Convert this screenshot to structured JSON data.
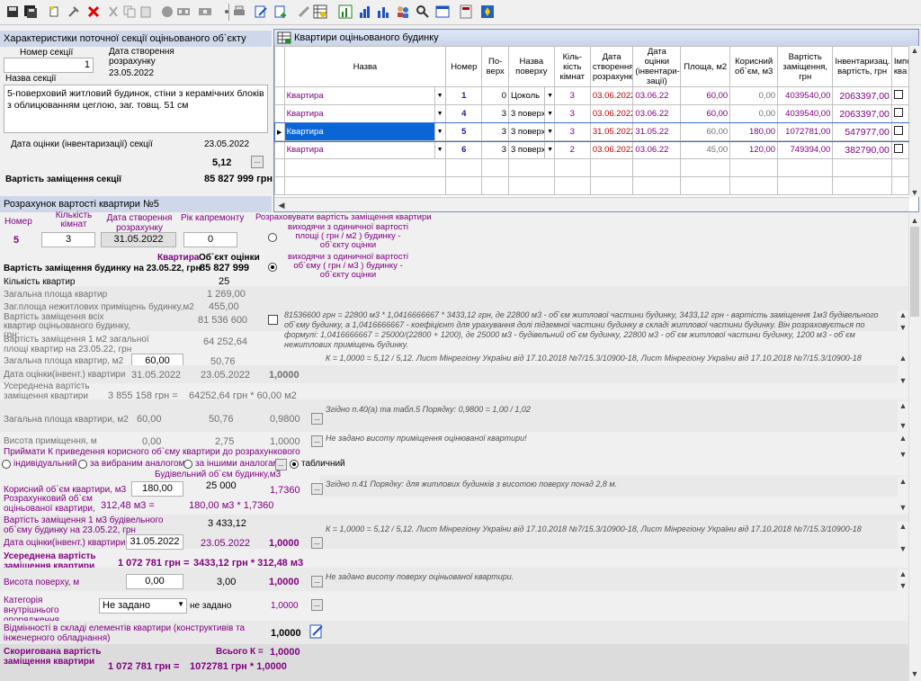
{
  "toolbar": {
    "icons": [
      "save-icon",
      "save-all-icon",
      "new-icon",
      "tools-icon",
      "delete-icon",
      "cut-icon",
      "copy-icon",
      "paste-icon",
      "circle-icon",
      "grid-icon",
      "grid2-icon",
      "dot-icon",
      "print-icon",
      "edit-icon",
      "add-icon",
      "pen-icon",
      "table-icon",
      "chart-icon",
      "chart2-icon",
      "users-icon",
      "search-icon",
      "window-icon",
      "calculator-icon",
      "emblem-icon"
    ]
  },
  "section": {
    "header": "Характеристики поточної секції оціньованого об`єкту",
    "num_label": "Номер секції",
    "num_value": "1",
    "date_label": "Дата створення розрахунку",
    "date_value": "23.05.2022",
    "name_label": "Назва секції",
    "description": "5-поверховий житловий будинок, стіни з керамічних блоків з облицюванням цеглою, заг. товщ. 51 см",
    "eval_date_label": "Дата оцінки (інвентаризації) секції",
    "eval_date_value": "23.05.2022",
    "k_value": "5,12",
    "cost_label": "Вартість заміщення секції",
    "cost_value": "85 827 999 грн"
  },
  "apt": {
    "header": "Розрахунок вартості квартири №5",
    "num_label": "Номер",
    "num_value": "5",
    "rooms_label": "Кількість кімнат",
    "rooms_value": "3",
    "created_label": "Дата створення розрахунку",
    "created_value": "31.05.2022",
    "repair_label": "Рік капремонту",
    "repair_value": "0",
    "calc_label": "Розраховувати вартість заміщення квартири",
    "radio1": "виходячи з одиничної вартості площі ( грн / м2 ) будинку - об`єкту оцінки",
    "radio2": "виходячи з одиничної вартості об`єму ( грн / м3 ) будинку - об`єкту оцінки",
    "col_apt": "Квартира",
    "col_obj": "Об`єкт оцінки",
    "bld_cost_label": "Вартість заміщення будинку на 23.05.22, грн",
    "bld_cost_value": "85 827 999",
    "rooms_count_label": "Кількість квартир",
    "rooms_count_value": "25",
    "total_area_label": "Загальна площа квартир",
    "total_area_value": "1 269,00",
    "nonres_label": "Заг.площа нежитлових приміщень будинку,м2",
    "nonres_value": "455,00",
    "all_apts_label": "Вартість заміщення всіх квартир оціньованого будинку, грн:",
    "all_apts_value": "81 536 600",
    "formula_note": "81536600 грн = 22800 м3 * 1,0416666667 * 3433,12 грн, де 22800 м3 - об`єм житлової частини будинку, 3433,12 грн - вартість заміщення 1м3 будівельного об`єму будинку, а 1,0416666667 - коефіцієнт для урахування долі підземної частини будинку в складі житлової частини будинку. Він розраховується по формулі: 1,0416666667 = 25000/(22800 + 1200), де 25000 м3 - будівельний об`єм будинку, 22800 м3 - об`єм житлової частини будинку, 1200 м3 - об`єм нежитлових приміщень будинку.",
    "cost_m2_label": "Вартість заміщення 1 м2 загальної площі квартир на 23.05.22, грн",
    "cost_m2_value": "64 252,64",
    "area_label": "Загальна площа квартир, м2",
    "area_apt": "60,00",
    "area_obj": "50,76",
    "eval_date_label": "Дата оцінки(інвент.) квартири",
    "eval_apt": "31.05.2022",
    "eval_obj": "23.05.2022",
    "eval_k": "1,0000",
    "k_note": "К = 1,0000 = 5,12 / 5,12. Лист Мінрегіону України від 17.10.2018 №7/15.3/10900-18, Лист Мінрегіону України від 17.10.2018 №7/15.3/10900-18",
    "avg_label": "Усереднена вартість заміщення квартири",
    "avg_value": "3 855 158 грн =",
    "avg_formula": "64252,64 грн * 60,00 м2",
    "area2_label": "Загальна площа квартири, м2",
    "area2_apt": "60,00",
    "area2_obj": "50,76",
    "area2_k": "0,9800",
    "area2_note": "Згідно п.40(а) та табл.5 Порядку: 0,9800 = 1,00 / 1,02",
    "height_label": "Висота приміщення, м",
    "height_apt": "0,00",
    "height_obj": "2,75",
    "height_k": "1,0000",
    "height_note": "Не задано висоту приміщення оцінюваної квартири!",
    "adopt_label": "Приймати К приведення корисного об`єму квартири до розрахункового",
    "opt1": "індивідуальний",
    "opt2": "за вибраним аналогом",
    "opt3": "за іншими аналогами",
    "opt4": "табличний",
    "bvol_label": "Будівельний об`єм будинку,м3",
    "bvol_value": "25 000",
    "usable_label": "Корисний об`єм квартири, м3",
    "usable_value": "180,00",
    "usable_k": "1,7360",
    "usable_note": "Згідно п.41 Порядку:  для житлових будинків з висотою поверху понад 2,8 м.",
    "calcvol_label": "Розрахунковий об`єм оціньованої квартири, м3",
    "calcvol_value": "312,48 м3 =",
    "calcvol_formula": "180,00 м3 * 1,7360",
    "cost_m3_label": "Вартість заміщення 1 м3 будівельного об`єму будинку на 23.05.22, грн",
    "cost_m3_value": "3 433,12",
    "eval2_label": "Дата оцінки(інвент.) квартири",
    "eval2_apt": "31.05.2022",
    "eval2_obj": "23.05.2022",
    "eval2_k": "1,0000",
    "eval2_note": "К = 1,0000 = 5,12 / 5,12. Лист Мінрегіону України від 17.10.2018 №7/15.3/10900-18, Лист Мінрегіону України від 17.10.2018 №7/15.3/10900-18",
    "avg2_label": "Усереднена вартість заміщення квартири",
    "avg2_value": "1 072 781 грн =",
    "avg2_formula": "3433,12 грн * 312,48 м3",
    "floor_h_label": "Висота поверху, м",
    "floor_h_apt": "0,00",
    "floor_h_obj": "3,00",
    "floor_h_k": "1,0000",
    "floor_h_note": "Не задано висоту поверху оціньованої квартири.",
    "finish_label": "Категорія внутрішнього опорядження",
    "finish_value": "Не задано",
    "finish_obj": "не задано",
    "finish_k": "1,0000",
    "diff_label": "Відмінності в складі елементів квартири (конструктивів та інженерного обладнання)",
    "diff_k": "1,0000",
    "adj_label": "Скоригована вартість заміщення квартири",
    "total_k_label": "Всього К =",
    "total_k": "1,0000",
    "adj_value": "1 072 781 грн =",
    "adj_formula": "1072781 грн * 1,0000"
  },
  "window": {
    "title": "Квартири оціньованого будинку",
    "headers": [
      "Назва",
      "Номер",
      "По-верх",
      "Назва поверху",
      "Кіль-кість кімнат",
      "Дата створення розрахунку",
      "Дата оцінки (інвентари-зації)",
      "Площа, м2",
      "Корисний об`єм, м3",
      "Вартість заміщення, грн",
      "Інвентаризац. вартість, грн",
      "Імпо ква"
    ],
    "rows": [
      {
        "name": "Квартира",
        "num": "1",
        "floor": "0",
        "floor_name": "Цоколь",
        "rooms": "3",
        "created": "03.06.2022",
        "eval": "03.06.22",
        "area": "60,00",
        "vol": "0,00",
        "cost": "4039540,00",
        "inv": "2063397,00"
      },
      {
        "name": "Квартира",
        "num": "4",
        "floor": "3",
        "floor_name": "3 поверх",
        "rooms": "3",
        "created": "03.06.2022",
        "eval": "03.06.22",
        "area": "60,00",
        "vol": "0,00",
        "cost": "4039540,00",
        "inv": "2063397,00"
      },
      {
        "name": "Квартира",
        "num": "5",
        "floor": "3",
        "floor_name": "3 поверх",
        "rooms": "3",
        "created": "31.05.2022",
        "eval": "31.05.22",
        "area": "60,00",
        "vol": "180,00",
        "cost": "1072781,00",
        "inv": "547977,00"
      },
      {
        "name": "Квартира",
        "num": "6",
        "floor": "3",
        "floor_name": "3 поверх",
        "rooms": "2",
        "created": "03.06.2022",
        "eval": "03.06.22",
        "area": "45,00",
        "vol": "120,00",
        "cost": "749394,00",
        "inv": "382790,00"
      }
    ]
  }
}
